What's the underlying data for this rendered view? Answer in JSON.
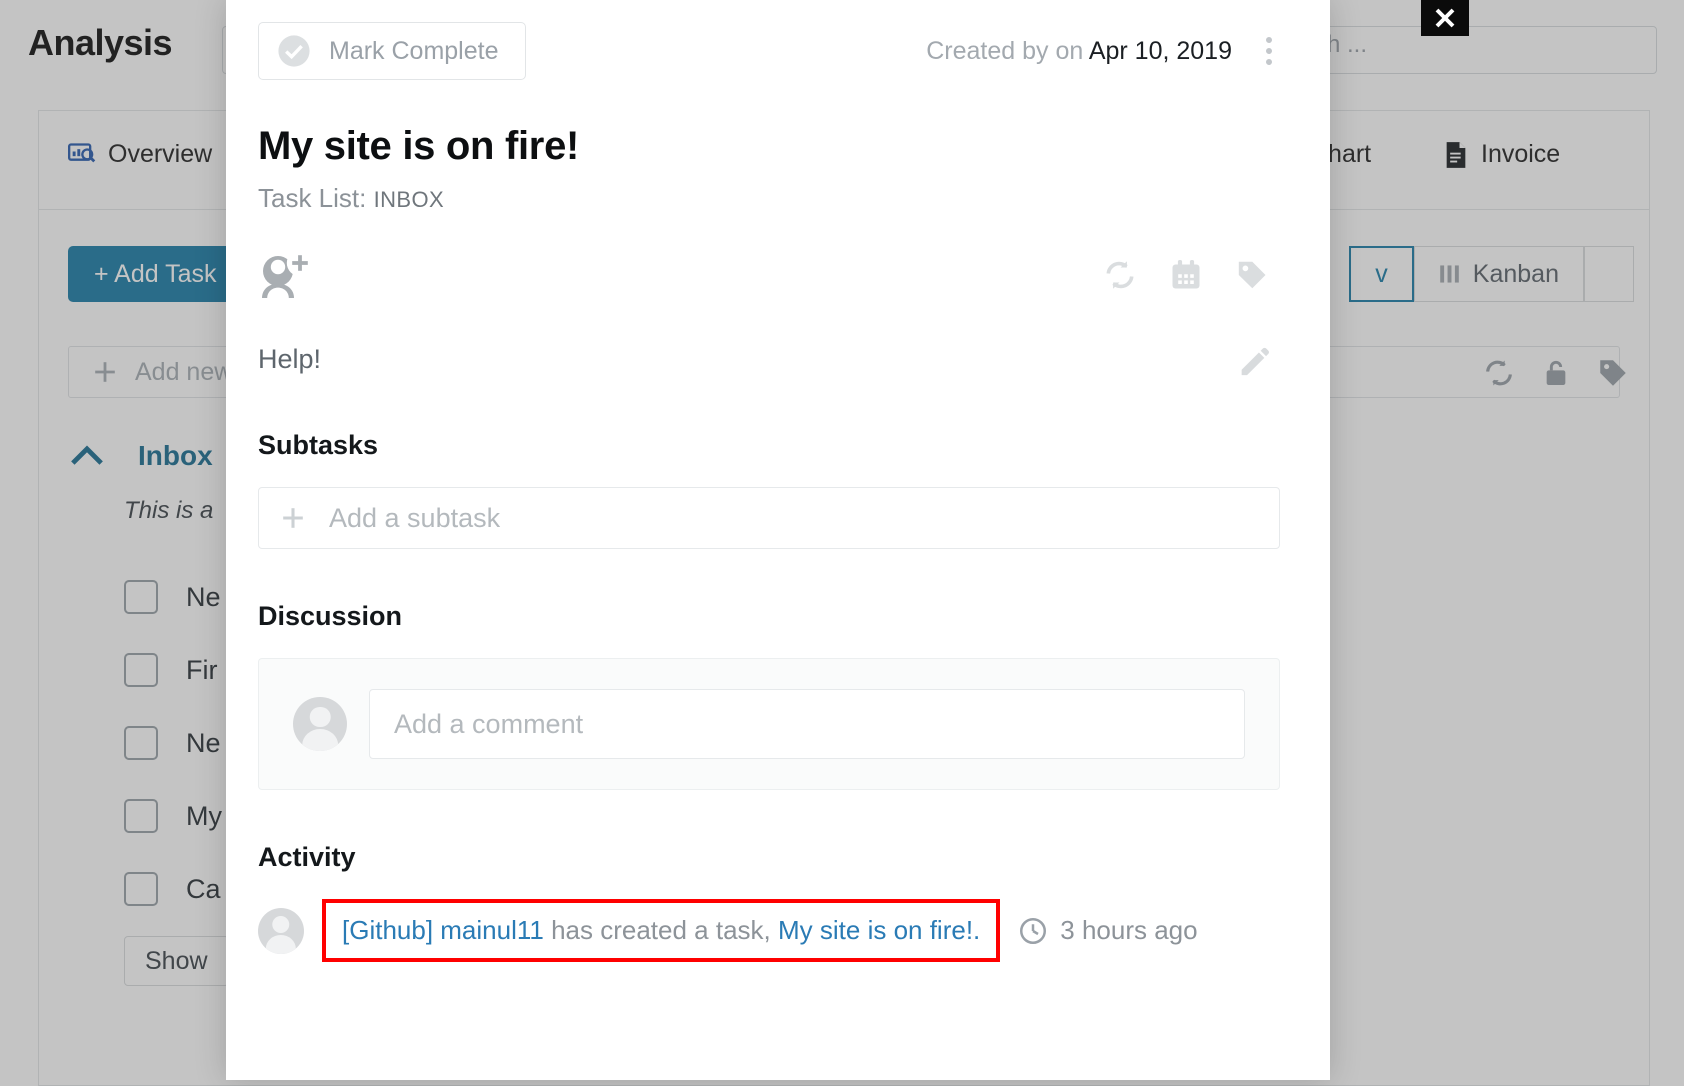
{
  "background": {
    "page_title": "Analysis",
    "search_placeholder": "rch ...",
    "tabs": [
      {
        "label": "Overview",
        "icon": "chart-monitor-icon"
      },
      {
        "label": "Chart",
        "icon": "none"
      },
      {
        "label": "Invoice",
        "icon": "invoice-document-icon"
      }
    ],
    "add_task_label": "+ Add Task",
    "add_new_label": "Add new",
    "view_buttons": [
      {
        "label": "v",
        "active": true
      },
      {
        "label": "Kanban",
        "icon": "kanban-columns-icon",
        "active": false
      }
    ],
    "inbox": {
      "label": "Inbox",
      "description": "This is a",
      "tasks": [
        "Ne",
        "Fir",
        "Ne",
        "My",
        "Ca"
      ],
      "show_button": "Show"
    },
    "toolbar_icons": [
      "refresh-icon",
      "lock-icon",
      "tag-icon"
    ]
  },
  "close_button": {
    "label": "✕"
  },
  "modal": {
    "mark_complete_label": "Mark Complete",
    "created_prefix": "Created by on",
    "created_date": "Apr 10, 2019",
    "title": "My site is on fire!",
    "task_list_label": "Task List:",
    "task_list_value": "INBOX",
    "meta_icons": [
      "refresh-icon",
      "calendar-icon",
      "tag-icon"
    ],
    "description": "Help!",
    "subtasks": {
      "heading": "Subtasks",
      "add_placeholder": "Add a subtask"
    },
    "discussion": {
      "heading": "Discussion",
      "comment_placeholder": "Add a comment"
    },
    "activity": {
      "heading": "Activity",
      "entries": [
        {
          "actor": "[Github] mainul11",
          "action": " has created a task, ",
          "target": "My site is on fire!.",
          "time": "3 hours ago"
        }
      ]
    }
  },
  "colors": {
    "accent_blue": "#1d7ea8",
    "link_blue": "#2a7bb5",
    "highlight_red": "#ff0000",
    "muted_gray": "#9aa1a8"
  }
}
